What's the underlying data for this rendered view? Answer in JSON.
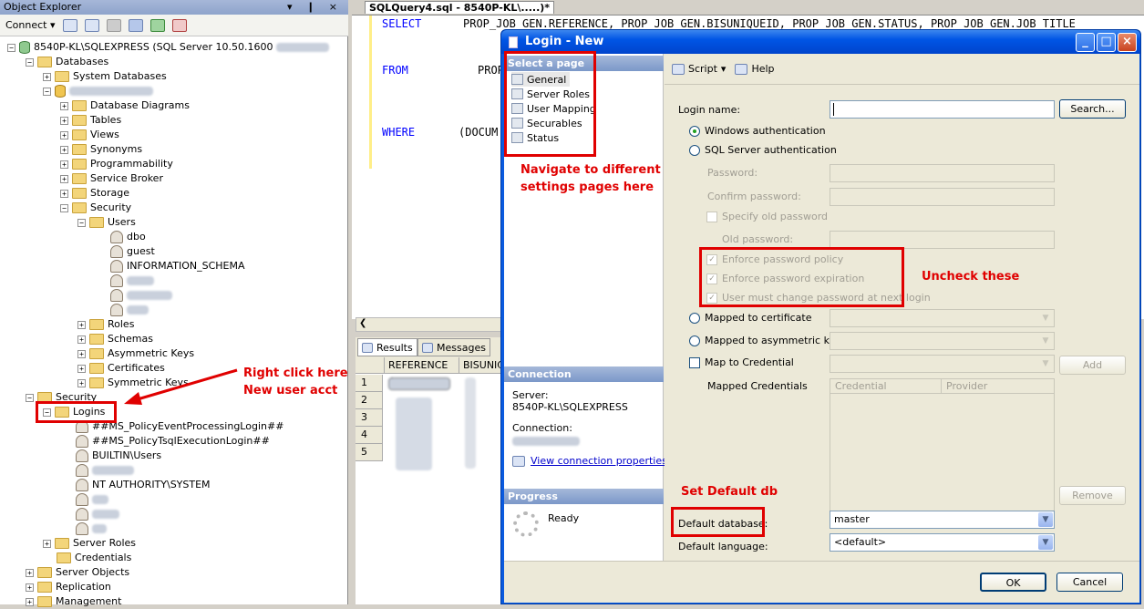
{
  "object_explorer": {
    "title": "Object Explorer",
    "title_buttons": "▾ ❙ ×",
    "connect_label": "Connect ▾",
    "server": "8540P-KL\\SQLEXPRESS (SQL Server 10.50.1600",
    "nodes": {
      "databases": "Databases",
      "system_databases": "System Databases",
      "db_diagrams": "Database Diagrams",
      "tables": "Tables",
      "views": "Views",
      "synonyms": "Synonyms",
      "programmability": "Programmability",
      "service_broker": "Service Broker",
      "storage": "Storage",
      "security_db": "Security",
      "users": "Users",
      "dbo": "dbo",
      "guest": "guest",
      "information_schema": "INFORMATION_SCHEMA",
      "roles": "Roles",
      "schemas": "Schemas",
      "asymmetric_keys": "Asymmetric Keys",
      "certificates": "Certificates",
      "symmetric_keys": "Symmetric Keys",
      "security": "Security",
      "logins": "Logins",
      "login1": "##MS_PolicyEventProcessingLogin##",
      "login2": "##MS_PolicyTsqlExecutionLogin##",
      "login3": "BUILTIN\\Users",
      "login4": "NT AUTHORITY\\SYSTEM",
      "server_roles": "Server Roles",
      "credentials": "Credentials",
      "server_objects": "Server Objects",
      "replication": "Replication",
      "management": "Management"
    }
  },
  "query": {
    "tab": "SQLQuery4.sql - 8540P-KL\\.....)*",
    "line1_kw": "SELECT",
    "line1_rest": "PROP_JOB_GEN.REFERENCE, PROP_JOB_GEN.BISUNIQUEID, PROP_JOB_GEN.STATUS, PROP_JOB_GEN.JOB_TITLE",
    "line2_kw": "FROM",
    "line2_rest": "PROP",
    "line3_kw": "WHERE",
    "line3_rest": "(DOCUM",
    "results_tab": "Results",
    "messages_tab": "Messages",
    "col1": "REFERENCE",
    "col2": "BISUNIC",
    "rows": [
      "1",
      "2",
      "3",
      "4",
      "5"
    ]
  },
  "dialog": {
    "title": "Login - New",
    "select_page": "Select a page",
    "pages": [
      "General",
      "Server Roles",
      "User Mapping",
      "Securables",
      "Status"
    ],
    "connection_header": "Connection",
    "server_label": "Server:",
    "server_value": "8540P-KL\\SQLEXPRESS",
    "connection_label": "Connection:",
    "view_conn": "View connection properties",
    "progress_header": "Progress",
    "progress_status": "Ready",
    "script": "Script",
    "help": "Help",
    "login_name": "Login name:",
    "search": "Search...",
    "windows_auth": "Windows authentication",
    "sql_auth": "SQL Server authentication",
    "password": "Password:",
    "confirm_password": "Confirm password:",
    "specify_old": "Specify old password",
    "old_password": "Old password:",
    "enforce_policy": "Enforce password policy",
    "enforce_expiration": "Enforce password expiration",
    "must_change": "User must change password at next login",
    "mapped_cert": "Mapped to certificate",
    "mapped_asym": "Mapped to asymmetric key",
    "map_credential": "Map to Credential",
    "add": "Add",
    "mapped_credentials": "Mapped Credentials",
    "cred_col": "Credential",
    "provider_col": "Provider",
    "remove": "Remove",
    "default_db_label": "Default database:",
    "default_db_value": "master",
    "default_lang_label": "Default language:",
    "default_lang_value": "<default>",
    "ok": "OK",
    "cancel": "Cancel"
  },
  "annotations": {
    "nav": [
      "Navigate to different",
      "settings pages here"
    ],
    "uncheck": "Uncheck these",
    "right_click": [
      "Right click here",
      "New user acct"
    ],
    "default_db": "Set Default db"
  },
  "colors": {
    "annotation_red": "#e00000",
    "dialog_blue": "#0a5adf"
  }
}
